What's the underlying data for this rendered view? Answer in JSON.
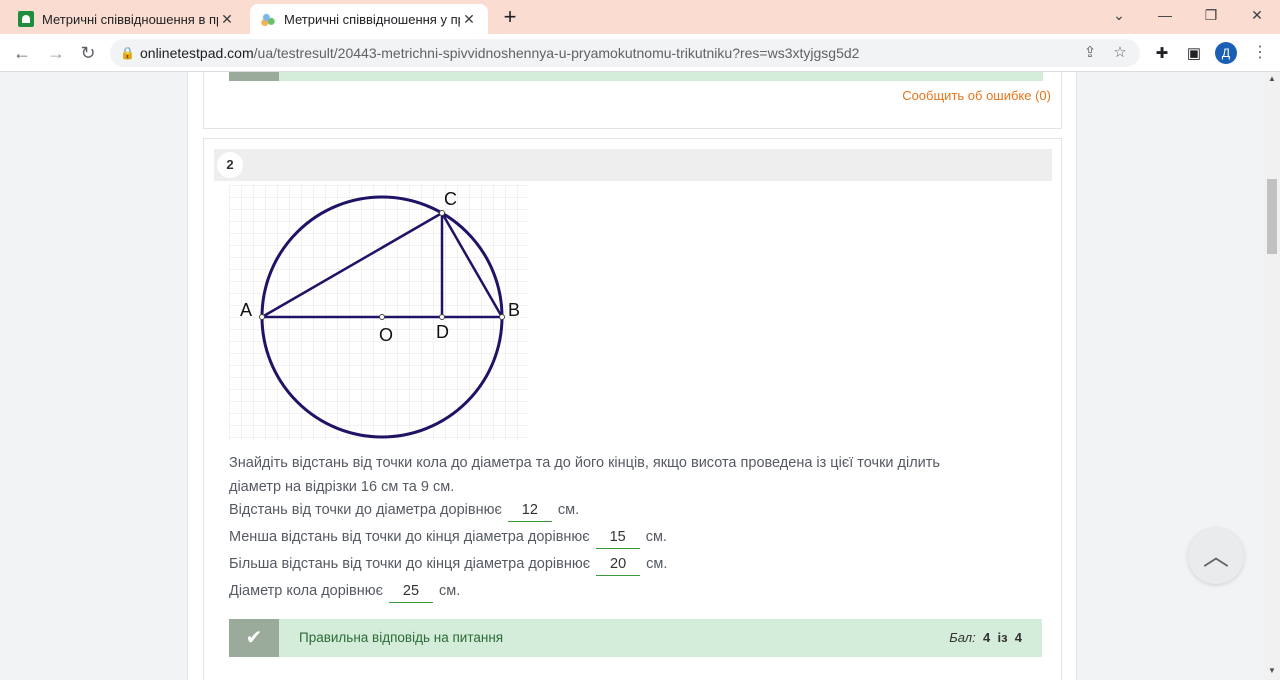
{
  "browser": {
    "tabs": [
      {
        "title": "Метричні співвідношення в пря",
        "active": false
      },
      {
        "title": "Метричні співвідношення у пря",
        "active": true
      }
    ],
    "url_host": "onlinetestpad.com",
    "url_path": "/ua/testresult/20443-metrichni-spivvidnoshennya-u-pryamokutnomu-trikutniku?res=ws3xtyjgsg5d2",
    "avatar_letter": "Д"
  },
  "page": {
    "report_error_label": "Сообщить об ошибке (0)",
    "question": {
      "number": "2",
      "figure_labels": {
        "a": "A",
        "b": "B",
        "c": "C",
        "d": "D",
        "o": "O"
      },
      "text_line1": "Знайдіть відстань від точки кола до діаметра та до його кінців, якщо висота проведена із цієї точки ділить",
      "text_line2": "діаметр на відрізки 16 см та 9 см.",
      "answers": [
        {
          "before": "Відстань від точки до діаметра дорівнює",
          "value": "12",
          "after": "см."
        },
        {
          "before": "Менша відстань від точки до кінця діаметра дорівнює",
          "value": "15",
          "after": "см."
        },
        {
          "before": "Більша відстань від точки до кінця діаметра дорівнює",
          "value": "20",
          "after": "см."
        },
        {
          "before": "Діаметр кола дорівнює",
          "value": "25",
          "after": "см."
        }
      ],
      "result_text": "Правильна відповідь на питання",
      "score_label": "Бал:",
      "score_value": "4",
      "score_of": "із",
      "score_max": "4"
    }
  },
  "colors": {
    "tabbar": "#fadcd0",
    "circle": "#1e1466",
    "result_bg": "#d4edda",
    "report_link": "#e8751a"
  }
}
